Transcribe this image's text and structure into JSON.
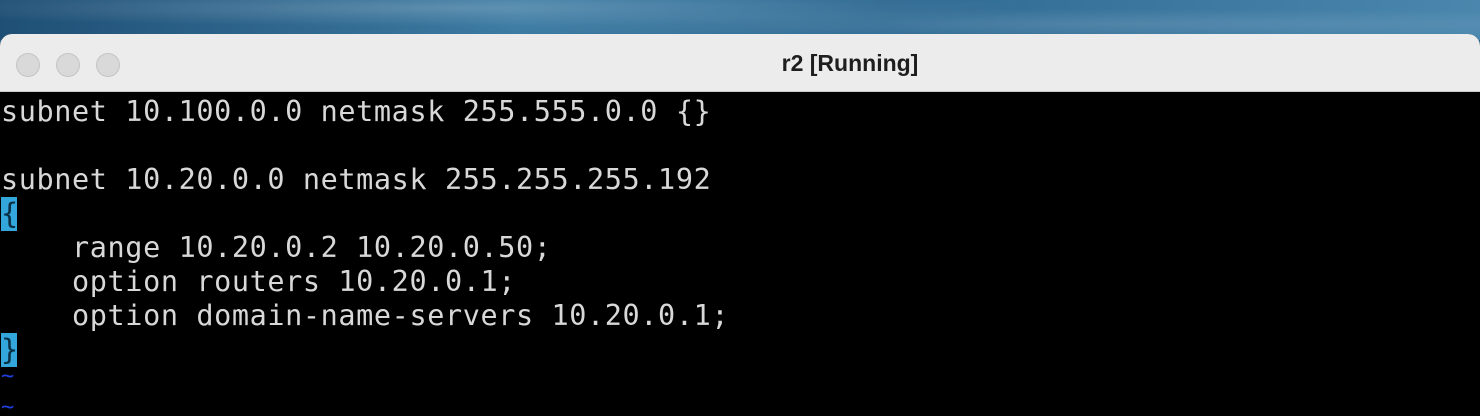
{
  "window": {
    "title": "r2 [Running]"
  },
  "terminal": {
    "lines": [
      "subnet 10.100.0.0 netmask 255.555.0.0 {}",
      "",
      "subnet 10.20.0.0 netmask 255.255.255.192",
      "{",
      "    range 10.20.0.2 10.20.0.50;",
      "    option routers 10.20.0.1;",
      "    option domain-name-servers 10.20.0.1;",
      "}",
      "~",
      "~"
    ]
  },
  "colors": {
    "terminal_bg": "#000000",
    "terminal_fg": "#d8d8d8",
    "brace_highlight": "#33a7dc",
    "tilde": "#1f3fe0",
    "titlebar_bg": "#ececec"
  },
  "icons": {
    "close": "traffic-light-close-icon",
    "minimize": "traffic-light-minimize-icon",
    "zoom": "traffic-light-zoom-icon"
  }
}
